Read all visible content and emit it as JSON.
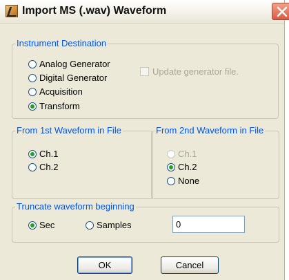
{
  "window": {
    "title": "Import MS (.wav) Waveform"
  },
  "icons": {
    "app": "waveform-app-icon",
    "close": "close-icon"
  },
  "instrument_destination": {
    "legend": "Instrument Destination",
    "options": [
      {
        "label": "Analog Generator",
        "checked": false
      },
      {
        "label": "Digital Generator",
        "checked": false
      },
      {
        "label": "Acquisition",
        "checked": false
      },
      {
        "label": "Transform",
        "checked": true
      }
    ],
    "update_checkbox": {
      "label": "Update generator file.",
      "checked": false,
      "enabled": false
    }
  },
  "first_waveform": {
    "legend": "From 1st Waveform in File",
    "options": [
      {
        "label": "Ch.1",
        "checked": true
      },
      {
        "label": "Ch.2",
        "checked": false
      }
    ]
  },
  "second_waveform": {
    "legend": "From 2nd Waveform in File",
    "options": [
      {
        "label": "Ch.1",
        "checked": false,
        "enabled": false
      },
      {
        "label": "Ch.2",
        "checked": true
      },
      {
        "label": "None",
        "checked": false
      }
    ]
  },
  "truncate": {
    "legend": "Truncate waveform beginning",
    "options": [
      {
        "label": "Sec",
        "checked": true
      },
      {
        "label": "Samples",
        "checked": false
      }
    ],
    "value": "0"
  },
  "buttons": {
    "ok": "OK",
    "cancel": "Cancel"
  },
  "colors": {
    "group_legend": "#0055e5",
    "radio_selected": "#21a121",
    "dialog_background": "#ece9d8"
  }
}
